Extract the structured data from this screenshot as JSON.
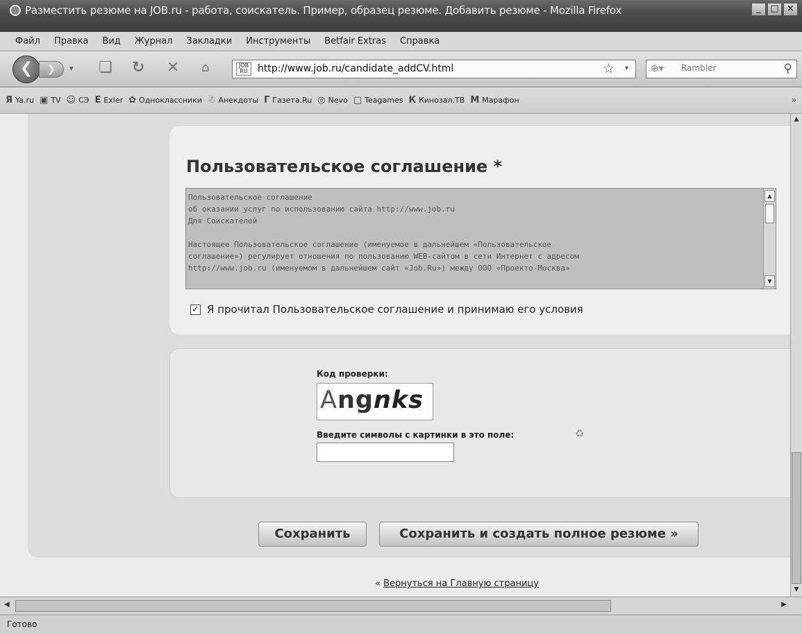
{
  "window": {
    "title": "Разместить резюме на JOB.ru - работа, соискатель. Пример, образец резюме. Добавить резюме - Mozilla Firefox",
    "controls": [
      "_",
      "□",
      "×"
    ]
  },
  "menu": [
    "Файл",
    "Правка",
    "Вид",
    "Журнал",
    "Закладки",
    "Инструменты",
    "Betfair Extras",
    "Справка"
  ],
  "navigation": {
    "url": "http://www.job.ru/candidate_addCV.html",
    "site_icon_label": "JOB RU",
    "search_placeholder": "Rambler"
  },
  "bookmarks": [
    {
      "icon": "Я",
      "label": "Ya.ru"
    },
    {
      "icon": "▣",
      "label": "TV"
    },
    {
      "icon": "☺",
      "label": "СЭ"
    },
    {
      "icon": "E",
      "label": "Exler"
    },
    {
      "icon": "✿",
      "label": "Одноклассники"
    },
    {
      "icon": "☃",
      "label": "Анекдоты"
    },
    {
      "icon": "Г",
      "label": "Газета.Ru"
    },
    {
      "icon": "◎",
      "label": "Nevo"
    },
    {
      "icon": "□",
      "label": "Teagames"
    },
    {
      "icon": "К",
      "label": "Кинозал.ТВ"
    },
    {
      "icon": "М",
      "label": "Марафон"
    }
  ],
  "agreement": {
    "title": "Пользовательское соглашение *",
    "text_lines": [
      "Пользовательское соглашение",
      "об оказании услуг по использованию сайта http://www.job.ru",
      "Для Соискателей",
      "",
      "Настоящее Пользовательское соглашение (именуемое в дальнейшем «Пользовательское",
      "соглашение») регулирует отношения по пользованию WEB-сайтом в сети Интернет с адресом",
      "http://www.job.ru (именуемом в дальнейшем сайт «Job.Ru») между ООО «Проекто-Москва»"
    ],
    "checkbox_checked": true,
    "checkbox_label": "Я прочитал Пользовательское соглашение и принимаю его условия"
  },
  "captcha": {
    "label": "Код проверки:",
    "image_text_part1": "A",
    "image_text_part2": "ng",
    "image_text_part3": "nks",
    "prompt": "Введите символы с картинки в это поле:",
    "input_value": ""
  },
  "buttons": {
    "save": "Сохранить",
    "save_full": "Сохранить и создать полное резюме »"
  },
  "back": {
    "prefix": "«",
    "link": "Вернуться на Главную страницу"
  },
  "status": "Готово"
}
